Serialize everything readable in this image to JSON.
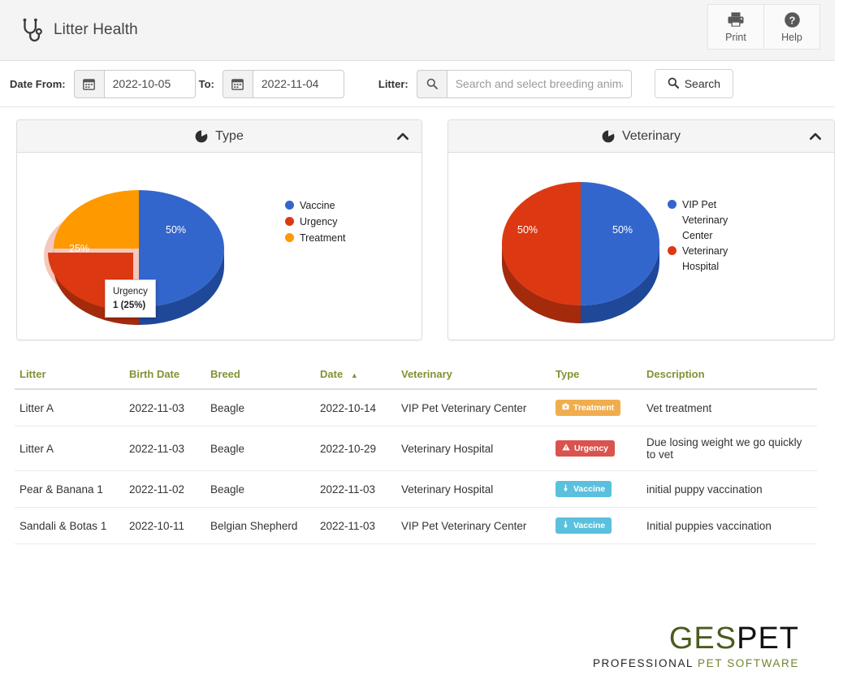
{
  "header": {
    "title": "Litter Health",
    "logo_icon": "stethoscope-icon",
    "actions": [
      {
        "id": "print",
        "label": "Print",
        "icon": "printer-icon"
      },
      {
        "id": "help",
        "label": "Help",
        "icon": "question-circle-icon"
      }
    ]
  },
  "filters": {
    "date_from_label": "Date From:",
    "date_from_value": "2022-10-05",
    "date_to_label": "To:",
    "date_to_value": "2022-11-04",
    "litter_label": "Litter:",
    "litter_placeholder": "Search and select breeding animal",
    "litter_value": "",
    "calendar_icon": "calendar-icon",
    "search_icon": "search-icon",
    "search_button_label": "Search"
  },
  "panels": [
    {
      "id": "type",
      "title": "Type",
      "icon": "pie-chart-icon",
      "collapse_icon": "chevron-up-icon"
    },
    {
      "id": "veterinary",
      "title": "Veterinary",
      "icon": "pie-chart-icon",
      "collapse_icon": "chevron-up-icon"
    }
  ],
  "tooltip": {
    "title": "Urgency",
    "value": "1 (25%)"
  },
  "chart_data": [
    {
      "type": "pie",
      "title": "Type",
      "labels": [
        "Vaccine",
        "Urgency",
        "Treatment"
      ],
      "values": [
        2,
        1,
        1
      ],
      "percentages": [
        "50%",
        "25%",
        "25%"
      ],
      "colors": [
        "#3366cc",
        "#dc3912",
        "#ff9900"
      ],
      "legend_position": "right",
      "three_d": true,
      "slice_labels": [
        "50%",
        "25%",
        "25%"
      ],
      "highlighted_slice": "Urgency",
      "tooltip": "Urgency 1 (25%)"
    },
    {
      "type": "pie",
      "title": "Veterinary",
      "labels": [
        "VIP Pet Veterinary Center",
        "Veterinary Hospital"
      ],
      "values": [
        2,
        2
      ],
      "percentages": [
        "50%",
        "50%"
      ],
      "colors": [
        "#3366cc",
        "#dc3912"
      ],
      "legend_position": "right",
      "three_d": true,
      "slice_labels": [
        "50%",
        "50%"
      ]
    }
  ],
  "table": {
    "columns": [
      {
        "key": "litter",
        "label": "Litter",
        "sorted": false
      },
      {
        "key": "birth_date",
        "label": "Birth Date",
        "sorted": false
      },
      {
        "key": "breed",
        "label": "Breed",
        "sorted": false
      },
      {
        "key": "date",
        "label": "Date",
        "sorted": true,
        "sort_dir": "asc",
        "sort_icon": "caret-up-icon"
      },
      {
        "key": "veterinary",
        "label": "Veterinary",
        "sorted": false
      },
      {
        "key": "type",
        "label": "Type",
        "sorted": false
      },
      {
        "key": "description",
        "label": "Description",
        "sorted": false
      }
    ],
    "rows": [
      {
        "litter": "Litter A",
        "birth_date": "2022-11-03",
        "breed": "Beagle",
        "date": "2022-10-14",
        "veterinary": "VIP Pet Veterinary Center",
        "type": "Treatment",
        "type_color": "#f0ad4e",
        "type_icon": "first-aid-kit-icon",
        "description": "Vet treatment"
      },
      {
        "litter": "Litter A",
        "birth_date": "2022-11-03",
        "breed": "Beagle",
        "date": "2022-10-29",
        "veterinary": "Veterinary Hospital",
        "type": "Urgency",
        "type_color": "#d9534f",
        "type_icon": "warning-triangle-icon",
        "description": "Due losing weight we go quickly to vet"
      },
      {
        "litter": "Pear & Banana 1",
        "birth_date": "2022-11-02",
        "breed": "Beagle",
        "date": "2022-11-03",
        "veterinary": "Veterinary Hospital",
        "type": "Vaccine",
        "type_color": "#5bc0de",
        "type_icon": "syringe-icon",
        "description": "initial puppy vaccination"
      },
      {
        "litter": "Sandali & Botas 1",
        "birth_date": "2022-10-11",
        "breed": "Belgian Shepherd",
        "date": "2022-11-03",
        "veterinary": "VIP Pet Veterinary Center",
        "type": "Vaccine",
        "type_color": "#5bc0de",
        "type_icon": "syringe-icon",
        "description": "Initial puppies vaccination"
      }
    ]
  },
  "footer": {
    "logo_part1": "GES",
    "logo_part2": "PET",
    "tagline_part1": "PROFESSIONAL",
    "tagline_part2": "PET SOFTWARE"
  },
  "colors": {
    "header_link": "#7f9335",
    "pie_blue": "#3366cc",
    "pie_red": "#dc3912",
    "pie_orange": "#ff9900",
    "badge_treatment": "#f0ad4e",
    "badge_urgency": "#d9534f",
    "badge_vaccine": "#5bc0de",
    "logo_green": "#4a5c1f"
  }
}
